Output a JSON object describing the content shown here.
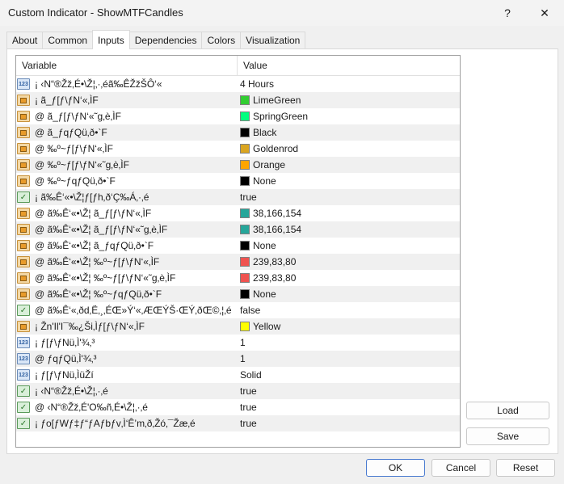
{
  "window": {
    "title": "Custom Indicator - ShowMTFCandles",
    "help_glyph": "?",
    "close_glyph": "✕"
  },
  "tabs": [
    "About",
    "Common",
    "Inputs",
    "Dependencies",
    "Colors",
    "Visualization"
  ],
  "active_tab": "Inputs",
  "table": {
    "columns": {
      "variable": "Variable",
      "value": "Value"
    },
    "rows": [
      {
        "type": "num",
        "name": "¡ ‹N“®Žž‚É•\\Ž¦‚·‚éã‰ÊŽžŠÔ‘«",
        "value": "4 Hours",
        "swatch": null
      },
      {
        "type": "color",
        "name": "¡ ã_ƒ[ƒ\\ƒN‘«‚ÌF",
        "value": "LimeGreen",
        "swatch": "#32cd32"
      },
      {
        "type": "color",
        "name": "@ ã_ƒ[ƒ\\ƒN‘«˜g‚è‚ÌF",
        "value": "SpringGreen",
        "swatch": "#00ff7f"
      },
      {
        "type": "color",
        "name": "@ ã_ƒqƒQü‚ð•`F",
        "value": "Black",
        "swatch": "#000000"
      },
      {
        "type": "color",
        "name": "@ ‰º~ƒ[ƒ\\ƒN‘«‚ÌF",
        "value": "Goldenrod",
        "swatch": "#daa520"
      },
      {
        "type": "color",
        "name": "@ ‰º~ƒ[ƒ\\ƒN‘«˜g‚è‚ÌF",
        "value": "Orange",
        "swatch": "#ffa500"
      },
      {
        "type": "color",
        "name": "@ ‰º~ƒqƒQü‚ð•`F",
        "value": "None",
        "swatch": "#000000"
      },
      {
        "type": "bool",
        "name": "¡ ã‰Ê‘«•\\Ž¦ƒ[ƒh‚ð‘Ç‰Á‚·‚é",
        "value": "true",
        "swatch": null
      },
      {
        "type": "color",
        "name": "@ ã‰Ê‘«•\\Ž¦ ã_ƒ[ƒ\\ƒN‘«‚ÌF",
        "value": "38,166,154",
        "swatch": "#26a69a"
      },
      {
        "type": "color",
        "name": "@ ã‰Ê‘«•\\Ž¦ ã_ƒ[ƒ\\ƒN‘«˜g‚è‚ÌF",
        "value": "38,166,154",
        "swatch": "#26a69a"
      },
      {
        "type": "color",
        "name": "@ ã‰Ê‘«•\\Ž¦ ã_ƒqƒQü‚ð•`F",
        "value": "None",
        "swatch": "#000000"
      },
      {
        "type": "color",
        "name": "@ ã‰Ê‘«•\\Ž¦ ‰º~ƒ[ƒ\\ƒN‘«‚ÌF",
        "value": "239,83,80",
        "swatch": "#ef5350"
      },
      {
        "type": "color",
        "name": "@ ã‰Ê‘«•\\Ž¦ ‰º~ƒ[ƒ\\ƒN‘«˜g‚è‚ÌF",
        "value": "239,83,80",
        "swatch": "#ef5350"
      },
      {
        "type": "color",
        "name": "@ ã‰Ê‘«•\\Ž¦ ‰º~ƒqƒQü‚ð•`F",
        "value": "None",
        "swatch": "#000000"
      },
      {
        "type": "bool",
        "name": "@ ã‰Ê‘«‚ðd‚Ë‚¸‚ÉŒ»Ý‘«‚ÆŒÝŠ·ŒÝ‚ðŒ©‚¦‚é",
        "value": "false",
        "swatch": null
      },
      {
        "type": "color",
        "name": "¡ Žn'Il'I¯‰¿Ši‚Ìƒ[ƒ\\ƒN‘«‚ÌF",
        "value": "Yellow",
        "swatch": "#ffff00"
      },
      {
        "type": "num",
        "name": "¡ ƒ[ƒ\\ƒNü‚Ì'¾‚³",
        "value": "1",
        "swatch": null
      },
      {
        "type": "num",
        "name": "@ ƒqƒQü‚Ì'¾‚³",
        "value": "1",
        "swatch": null
      },
      {
        "type": "num",
        "name": "¡ ƒ[ƒ\\ƒNü‚ÌüŽí",
        "value": "Solid",
        "swatch": null
      },
      {
        "type": "bool",
        "name": "¡ ‹N“®Žž‚É•\\Ž¦‚·‚é",
        "value": "true",
        "swatch": null
      },
      {
        "type": "bool",
        "name": "@ ‹N“®Žž‚É'O‰ñ‚É•\\Ž¦‚·‚é",
        "value": "true",
        "swatch": null
      },
      {
        "type": "bool",
        "name": "¡ ƒo[ƒWƒ‡ƒ“ƒAƒbƒv‚Ì‘Ê’m‚ð‚Žó‚¯Žæ‚é",
        "value": "true",
        "swatch": null
      }
    ]
  },
  "side_buttons": {
    "load": "Load",
    "save": "Save"
  },
  "bottom_buttons": {
    "ok": "OK",
    "cancel": "Cancel",
    "reset": "Reset"
  }
}
